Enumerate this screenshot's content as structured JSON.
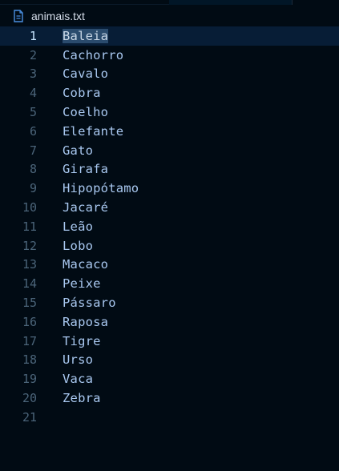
{
  "breadcrumb": {
    "file_icon": "file-text-icon",
    "file_name": "animais.txt"
  },
  "editor": {
    "current_line": 1,
    "lines": [
      {
        "number": "1",
        "text": "Baleia"
      },
      {
        "number": "2",
        "text": "Cachorro"
      },
      {
        "number": "3",
        "text": "Cavalo"
      },
      {
        "number": "4",
        "text": "Cobra"
      },
      {
        "number": "5",
        "text": "Coelho"
      },
      {
        "number": "6",
        "text": "Elefante"
      },
      {
        "number": "7",
        "text": "Gato"
      },
      {
        "number": "8",
        "text": "Girafa"
      },
      {
        "number": "9",
        "text": "Hipopótamo"
      },
      {
        "number": "10",
        "text": "Jacaré"
      },
      {
        "number": "11",
        "text": "Leão"
      },
      {
        "number": "12",
        "text": "Lobo"
      },
      {
        "number": "13",
        "text": "Macaco"
      },
      {
        "number": "14",
        "text": "Peixe"
      },
      {
        "number": "15",
        "text": "Pássaro"
      },
      {
        "number": "16",
        "text": "Raposa"
      },
      {
        "number": "17",
        "text": "Tigre"
      },
      {
        "number": "18",
        "text": "Urso"
      },
      {
        "number": "19",
        "text": "Vaca"
      },
      {
        "number": "20",
        "text": "Zebra"
      },
      {
        "number": "21",
        "text": ""
      }
    ]
  },
  "colors": {
    "background": "#010b14",
    "text": "#a9c8f0",
    "line_number": "#4b6479",
    "current_line_highlight": "#071d36",
    "selection": "#2a4b6d"
  }
}
